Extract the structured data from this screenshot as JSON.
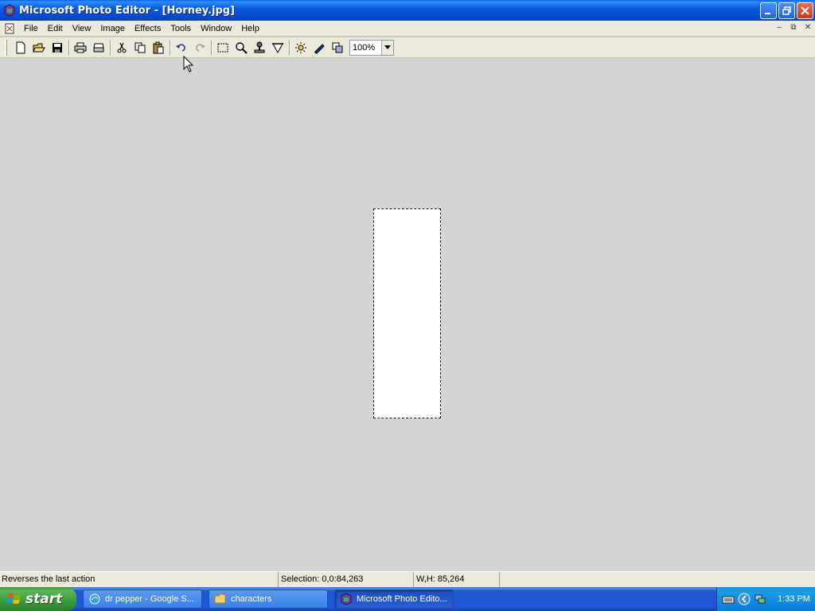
{
  "window": {
    "title": "Microsoft Photo Editor - [Horney.jpg]"
  },
  "menu": {
    "items": [
      "File",
      "Edit",
      "View",
      "Image",
      "Effects",
      "Tools",
      "Window",
      "Help"
    ]
  },
  "toolbar": {
    "zoom_value": "100%"
  },
  "statusbar": {
    "message": "Reverses the last action",
    "selection": "Selection: 0,0:84,263",
    "size": "W,H: 85,264"
  },
  "taskbar": {
    "start_label": "start",
    "tasks": [
      {
        "label": "dr pepper - Google S...",
        "icon": "browser-icon",
        "active": false
      },
      {
        "label": "characters",
        "icon": "folder-icon",
        "active": false
      },
      {
        "label": "Microsoft Photo Edito...",
        "icon": "photo-editor-icon",
        "active": true
      }
    ],
    "clock": "1:33 PM"
  },
  "colors": {
    "titlebar": "#0b5ce0",
    "workspace": "#d4d4d4",
    "taskbar": "#2157d7",
    "start": "#3b9a3b"
  }
}
